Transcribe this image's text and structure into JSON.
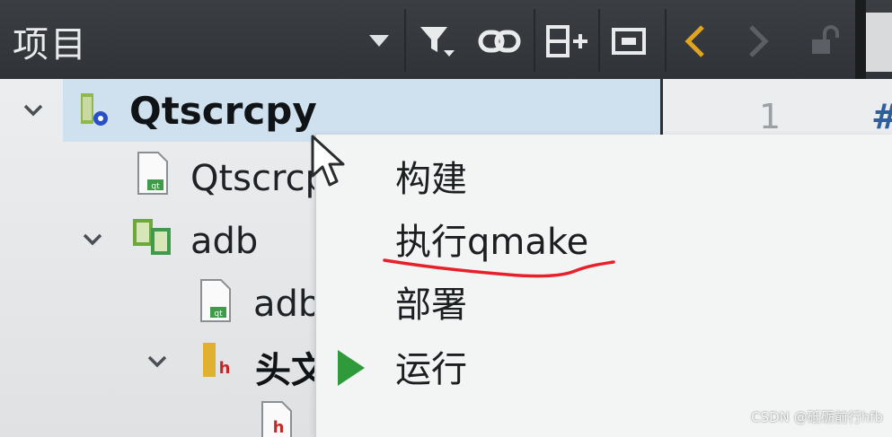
{
  "toolbar": {
    "title": "项目",
    "icons": [
      "dropdown-triangle-icon",
      "filter-icon",
      "link-icon",
      "split-add-icon",
      "window-icon",
      "back-arrow-icon",
      "forward-arrow-icon",
      "lock-icon"
    ],
    "accent_color": "#e0a420"
  },
  "tree": {
    "project": {
      "name": "Qtscrcpy",
      "expanded": true
    },
    "items": [
      {
        "label": "Qtscrcp"
      },
      {
        "label": "adb",
        "expanded": true
      },
      {
        "label": "adb"
      },
      {
        "label": "头文"
      }
    ]
  },
  "editor": {
    "line_number": "1",
    "first_char": "#"
  },
  "context_menu": {
    "items": [
      {
        "label": "构建"
      },
      {
        "label": "执行qmake",
        "highlighted": true
      },
      {
        "label": "部署"
      },
      {
        "label": "运行",
        "icon": "run-icon",
        "color": "#2f9a3c"
      }
    ]
  },
  "annotation": {
    "underline_color": "#e8202a"
  },
  "watermark": {
    "text": "CSDN @砥砺前行hfb"
  }
}
